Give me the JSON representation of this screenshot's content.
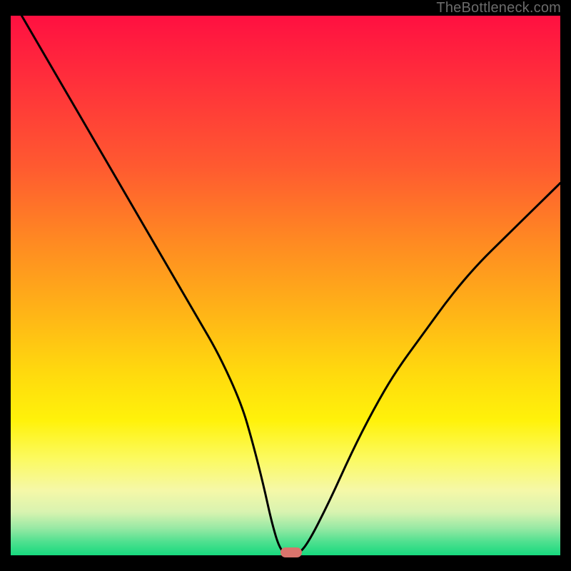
{
  "watermark": "TheBottleneck.com",
  "colors": {
    "curve_stroke": "#000000",
    "marker_fill": "#d9746c"
  },
  "chart_data": {
    "type": "line",
    "title": "",
    "xlabel": "",
    "ylabel": "",
    "xlim": [
      0,
      100
    ],
    "ylim": [
      0,
      100
    ],
    "grid": false,
    "legend": false,
    "series": [
      {
        "name": "bottleneck-curve",
        "x": [
          2,
          6,
          10,
          14,
          18,
          22,
          26,
          30,
          34,
          38,
          42,
          44,
          46,
          47.5,
          49,
          50.5,
          52,
          54,
          58,
          62,
          66,
          70,
          75,
          80,
          85,
          90,
          95,
          100
        ],
        "y": [
          100,
          93,
          86,
          79,
          72,
          65,
          58,
          51,
          44,
          37,
          28,
          21,
          13,
          6,
          1,
          0,
          0,
          2,
          10,
          19,
          27,
          34,
          41,
          48,
          54,
          59,
          64,
          69
        ]
      }
    ],
    "marker": {
      "x": 51,
      "y": 0
    }
  }
}
